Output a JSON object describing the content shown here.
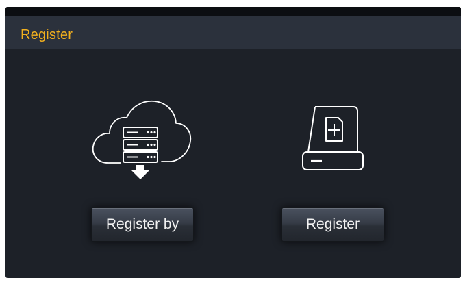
{
  "dialog": {
    "title": "Register"
  },
  "options": [
    {
      "icon": "cloud-server-download-icon",
      "button_label": "Register by"
    },
    {
      "icon": "storage-card-add-icon",
      "button_label": "Register"
    }
  ],
  "colors": {
    "title_text": "#f2b01e",
    "background": "#1d2128",
    "title_bar": "#2b313c",
    "icon_stroke": "#ffffff"
  }
}
